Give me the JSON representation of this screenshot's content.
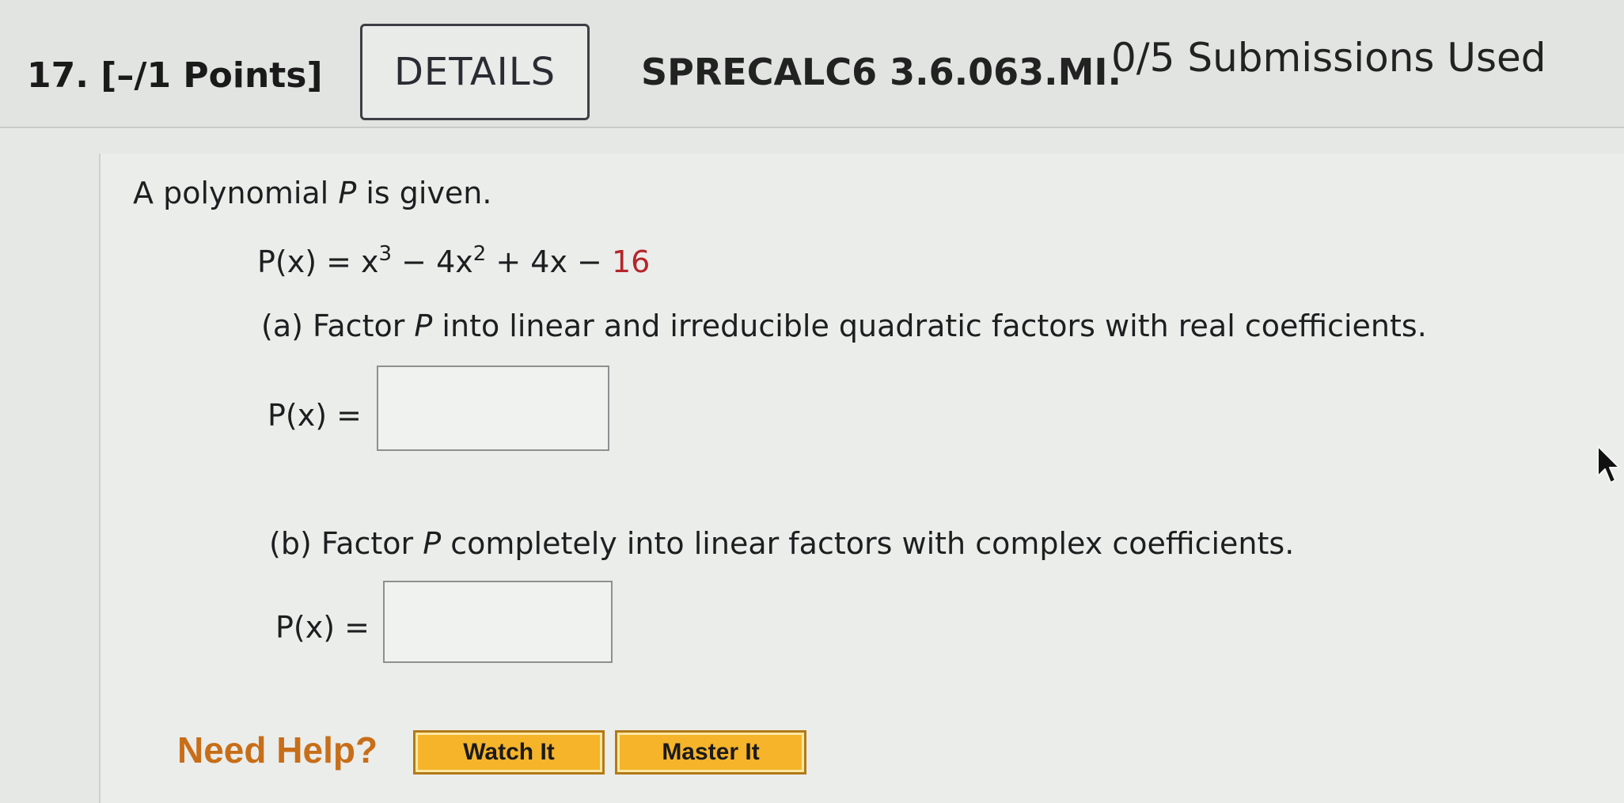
{
  "header": {
    "question_number": "17.",
    "points": "[–/1 Points]",
    "details_label": "DETAILS",
    "problem_code": "SPRECALC6 3.6.063.MI.",
    "submissions": "0/5 Submissions Used"
  },
  "problem": {
    "intro_prefix": "A polynomial ",
    "intro_var": "P",
    "intro_suffix": " is given.",
    "poly_lhs": "P(x) = x",
    "exp3": "3",
    "minus_4x": " − 4x",
    "exp2": "2",
    "plus_4x": " + 4x − ",
    "constant": "16",
    "part_a_prefix": "(a) Factor ",
    "part_a_var": "P",
    "part_a_suffix": " into linear and irreducible quadratic factors with real coefficients.",
    "part_a_label": "P(x) =",
    "part_a_value": "",
    "part_b_prefix": "(b) Factor ",
    "part_b_var": "P",
    "part_b_suffix": " completely into linear factors with complex coefficients.",
    "part_b_label": "P(x) =",
    "part_b_value": ""
  },
  "help": {
    "label": "Need Help?",
    "watch_it": "Watch It",
    "master_it": "Master It"
  },
  "colors": {
    "constant_red": "#b5262a",
    "need_help_orange": "#c86e18",
    "button_gold": "#f5b42a"
  },
  "icons": {
    "cursor": "mouse-pointer-icon"
  }
}
